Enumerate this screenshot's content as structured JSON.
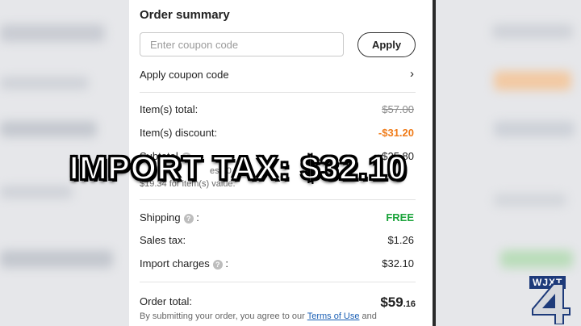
{
  "order_summary": {
    "title": "Order summary",
    "coupon_placeholder": "Enter coupon code",
    "apply_label": "Apply",
    "apply_coupon_label": "Apply coupon code",
    "items_total_label": "Item(s) total:",
    "items_total_value": "$57.00",
    "items_discount_label": "Item(s) discount:",
    "items_discount_value": "-$31.20",
    "subtotal_label": "Subtotal",
    "subtotal_value": "$25.80",
    "partial_note_1": "es $0",
    "partial_note_2": "$19.34 for item(s) value.",
    "shipping_label": "Shipping",
    "shipping_value": "FREE",
    "sales_tax_label": "Sales tax:",
    "sales_tax_value": "$1.26",
    "import_charges_label": "Import charges",
    "import_charges_value": "$32.10",
    "order_total_label": "Order total:",
    "order_total_dollars": "$59",
    "order_total_cents": ".16",
    "terms_prefix": "By submitting your order, you agree to our ",
    "terms_link": "Terms of Use",
    "terms_suffix": " and"
  },
  "caption": "IMPORT TAX: $32.10",
  "station_logo": "WJXT",
  "colors": {
    "discount": "#f07c1a",
    "free_shipping": "#1aa33a",
    "link": "#1a5fb4"
  }
}
